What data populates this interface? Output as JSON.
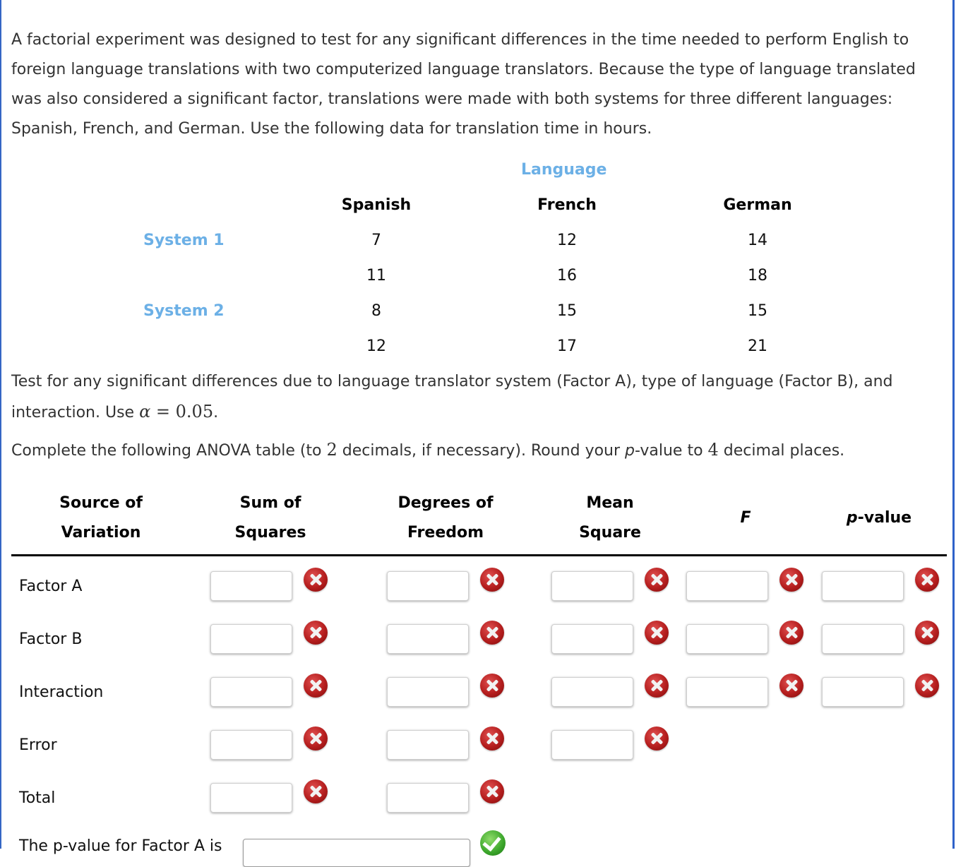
{
  "intro": {
    "paragraph": "A factorial experiment was designed to test for any significant differences in the time needed to perform English to foreign language translations with two computerized language translators. Because the type of language translated was also considered a significant factor, translations were made with both systems for three different languages: Spanish, French, and German. Use the following data for translation time in hours."
  },
  "data_table": {
    "column_group_label": "Language",
    "columns": [
      "Spanish",
      "French",
      "German"
    ],
    "rows": [
      {
        "label": "System 1",
        "values": [
          [
            7,
            11
          ],
          [
            12,
            16
          ],
          [
            14,
            18
          ]
        ]
      },
      {
        "label": "System 2",
        "values": [
          [
            8,
            12
          ],
          [
            15,
            17
          ],
          [
            15,
            21
          ]
        ]
      }
    ]
  },
  "instructions": {
    "test_text_prefix": "Test for any significant differences due to language translator system (Factor A), type of language (Factor B), and interaction. Use ",
    "alpha_symbol": "α",
    "alpha_eq": " = ",
    "alpha_value": "0.05",
    "test_text_suffix": ".",
    "complete_prefix": "Complete the following ANOVA table (to ",
    "decimals": "2",
    "complete_mid": " decimals, if necessary). Round your ",
    "p_italic": "p",
    "complete_mid2": "-value to ",
    "p_decimals": "4",
    "complete_suffix": " decimal places."
  },
  "anova": {
    "headers": {
      "source": [
        "Source of",
        "Variation"
      ],
      "ss": [
        "Sum of",
        "Squares"
      ],
      "df": [
        "Degrees of",
        "Freedom"
      ],
      "ms": [
        "Mean",
        "Square"
      ],
      "f": "F",
      "p_italic": "p",
      "p_rest": "-value"
    },
    "rows": [
      {
        "label": "Factor A",
        "ss": "",
        "df": "",
        "ms": "",
        "f": "",
        "p": "",
        "status": "incorrect"
      },
      {
        "label": "Factor B",
        "ss": "",
        "df": "",
        "ms": "",
        "f": "",
        "p": "",
        "status": "incorrect"
      },
      {
        "label": "Interaction",
        "ss": "",
        "df": "",
        "ms": "",
        "f": "",
        "p": "",
        "status": "incorrect"
      },
      {
        "label": "Error",
        "ss": "",
        "df": "",
        "ms": "",
        "status": "incorrect"
      },
      {
        "label": "Total",
        "ss": "",
        "df": "",
        "status": "incorrect"
      }
    ]
  },
  "followup": {
    "partial_text": "The p-value for Factor A is",
    "select_value": "",
    "status": "correct"
  },
  "colors": {
    "accent_label": "#6cb0e6",
    "frame_border": "#2f62c9",
    "incorrect": "#b51e1e",
    "correct": "#3aa52a"
  }
}
